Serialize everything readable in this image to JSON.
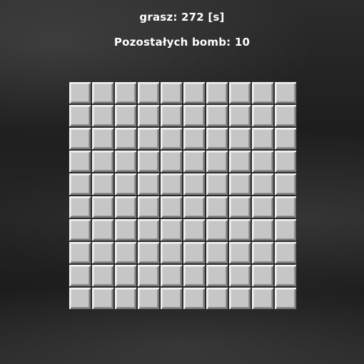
{
  "header": {
    "timer_label": "grasz:",
    "timer_value": "272",
    "timer_unit": "[s]",
    "bombs_label": "Pozostałych bomb:",
    "bombs_value": "10"
  },
  "board": {
    "rows": 10,
    "cols": 10,
    "cell_state": "covered",
    "cell_color": "#c6c6c6"
  }
}
